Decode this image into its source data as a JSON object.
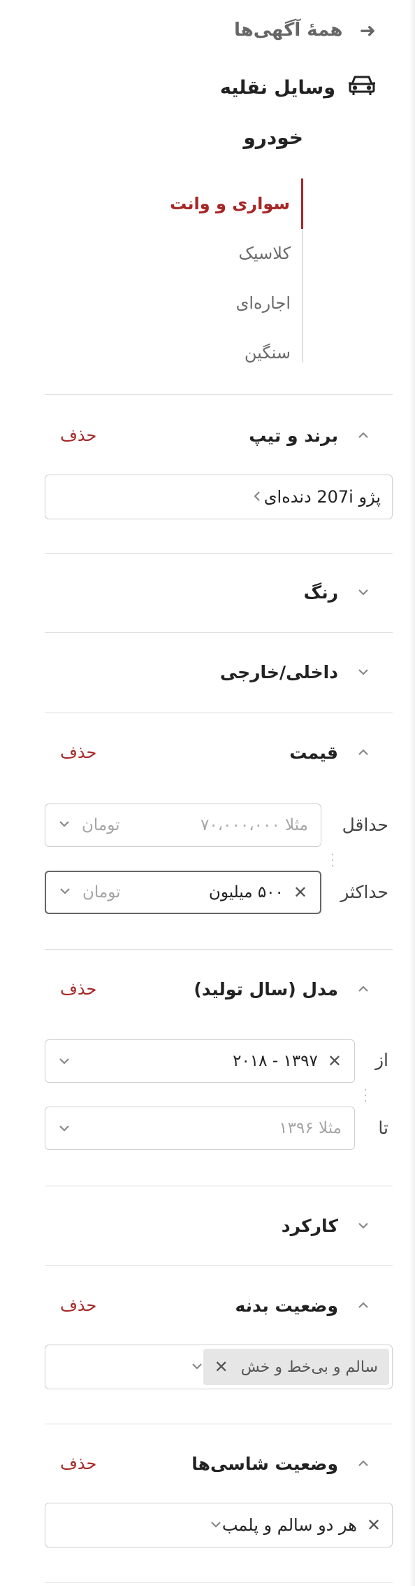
{
  "nav": {
    "all_ads_label": "همهٔ آگهی‌ها",
    "category_label": "وسایل نقلیه"
  },
  "subcategory": {
    "title": "خودرو",
    "items": [
      {
        "label": "سواری و وانت",
        "active": true
      },
      {
        "label": "کلاسیک",
        "active": false
      },
      {
        "label": "اجاره‌ای",
        "active": false
      },
      {
        "label": "سنگین",
        "active": false
      }
    ]
  },
  "filters": {
    "brand": {
      "title": "برند و تیپ",
      "delete_label": "حذف",
      "value": "پژو 207i دنده‌ای"
    },
    "color": {
      "title": "رنگ"
    },
    "origin": {
      "title": "داخلی/خارجی"
    },
    "price": {
      "title": "قیمت",
      "delete_label": "حذف",
      "min_label": "حداقل",
      "min_placeholder": "مثلا ۷۰،۰۰۰،۰۰۰",
      "min_unit": "تومان",
      "max_label": "حداکثر",
      "max_value": "۵۰۰ میلیون",
      "max_unit": "تومان"
    },
    "model_year": {
      "title": "مدل (سال تولید)",
      "delete_label": "حذف",
      "from_label": "از",
      "from_value": "۱۳۹۷ - ۲۰۱۸",
      "to_label": "تا",
      "to_placeholder": "مثلا ۱۳۹۶"
    },
    "mileage": {
      "title": "کارکرد"
    },
    "body_status": {
      "title": "وضعیت بدنه",
      "delete_label": "حذف",
      "chip": "سالم و بی‌خط و خش"
    },
    "chassis_status": {
      "title": "وضعیت شاسی‌ها",
      "delete_label": "حذف",
      "value": "هر دو سالم و پلمب"
    }
  },
  "icons": {
    "arrow": "arrow-right-icon",
    "car": "car-icon",
    "collapse": "chevron-up-icon",
    "expand": "chevron-down-icon",
    "clear": "clear-x-icon"
  },
  "colors": {
    "accent": "#a62626",
    "text": "#222222",
    "muted": "#999999"
  }
}
